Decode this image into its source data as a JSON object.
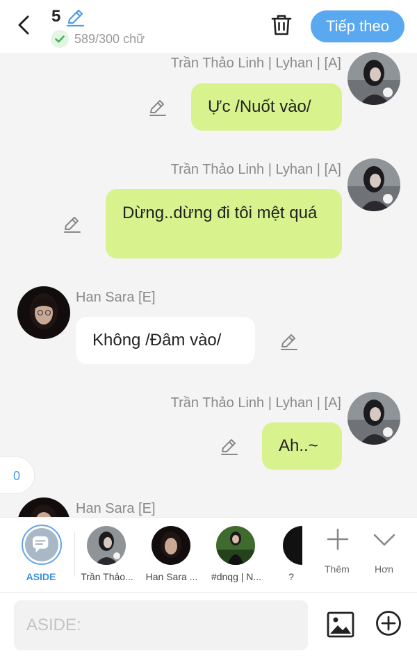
{
  "header": {
    "chapter_number": "5",
    "word_count": "589/300 chữ",
    "next_label": "Tiếp theo"
  },
  "messages": [
    {
      "sender": "Trần Thảo Linh | Lyhan | [A]",
      "text": "Ực /Nuốt vào/",
      "side": "right"
    },
    {
      "sender": "Trần Thảo Linh | Lyhan | [A]",
      "text": "Dừng..dừng đi tôi mệt quá",
      "side": "right"
    },
    {
      "sender": "Han Sara [E]",
      "text": "Không /Đâm vào/",
      "side": "left"
    },
    {
      "sender": "Trần Thảo Linh | Lyhan | [A]",
      "text": "Ah..~",
      "side": "right"
    },
    {
      "sender": "Han Sara [E]",
      "text": "",
      "side": "left"
    }
  ],
  "counter_badge": "0",
  "characters": [
    {
      "label": "ASIDE",
      "icon": "chat-bubble-icon"
    },
    {
      "label": "Trần Thảo..."
    },
    {
      "label": "Han Sara ..."
    },
    {
      "label": "#dnqg | N..."
    },
    {
      "label": "?"
    }
  ],
  "actions": {
    "add_label": "Thêm",
    "more_label": "Hơn"
  },
  "input": {
    "placeholder": "ASIDE:"
  },
  "colors": {
    "accent": "#5aa9f0",
    "bubble_green": "#d8f28e",
    "bubble_white": "#ffffff"
  }
}
